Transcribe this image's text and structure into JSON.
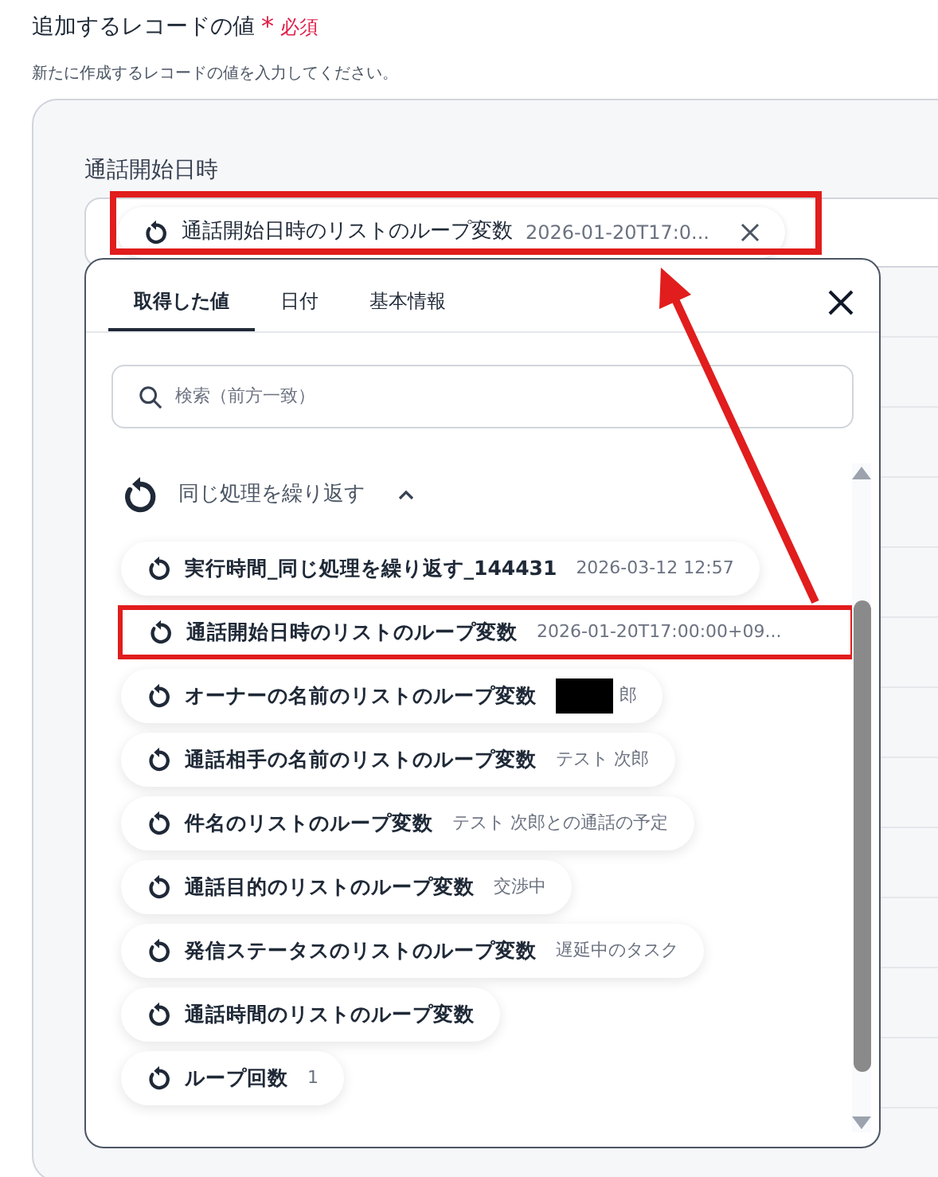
{
  "section": {
    "title": "追加するレコードの値",
    "required_mark": "*",
    "required_label": "必須",
    "description": "新たに作成するレコードの値を入力してください。"
  },
  "field": {
    "label": "通話開始日時",
    "chip": {
      "name": "通話開始日時のリストのループ変数",
      "value": "2026-01-20T17:0...",
      "highlighted": true
    }
  },
  "picker": {
    "tabs": [
      {
        "label": "取得した値",
        "selected": true
      },
      {
        "label": "日付",
        "selected": false
      },
      {
        "label": "基本情報",
        "selected": false
      }
    ],
    "search": {
      "placeholder": "検索（前方一致）"
    },
    "group": {
      "title": "同じ処理を繰り返す",
      "expanded": true,
      "items": [
        {
          "name": "実行時間_同じ処理を繰り返す_144431",
          "value": "2026-03-12 12:57",
          "highlighted": false,
          "redacted": false
        },
        {
          "name": "通話開始日時のリストのループ変数",
          "value": "2026-01-20T17:00:00+09...",
          "highlighted": true,
          "redacted": false
        },
        {
          "name": "オーナーの名前のリストのループ変数",
          "value": "郎",
          "highlighted": false,
          "redacted": true
        },
        {
          "name": "通話相手の名前のリストのループ変数",
          "value": "テスト 次郎",
          "highlighted": false,
          "redacted": false
        },
        {
          "name": "件名のリストのループ変数",
          "value": "テスト 次郎との通話の予定",
          "highlighted": false,
          "redacted": false
        },
        {
          "name": "通話目的のリストのループ変数",
          "value": "交渉中",
          "highlighted": false,
          "redacted": false
        },
        {
          "name": "発信ステータスのリストのループ変数",
          "value": "遅延中のタスク",
          "highlighted": false,
          "redacted": false
        },
        {
          "name": "通話時間のリストのループ変数",
          "highlighted": false,
          "redacted": false
        },
        {
          "name": "ループ回数",
          "value": "1",
          "highlighted": false,
          "redacted": false
        }
      ]
    }
  }
}
